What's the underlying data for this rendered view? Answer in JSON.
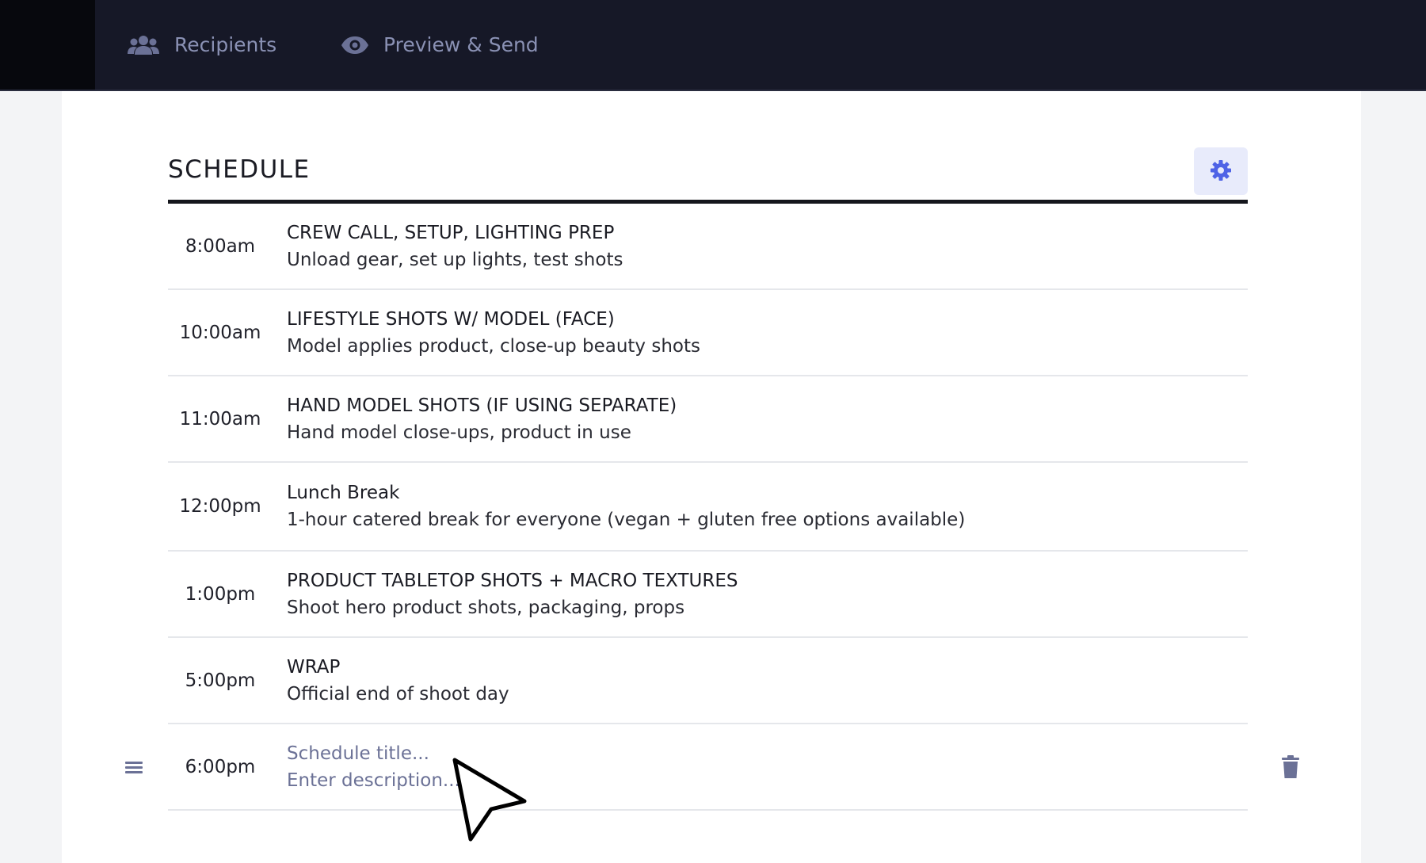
{
  "nav": {
    "items": [
      {
        "label": "Recipients",
        "icon": "users-icon"
      },
      {
        "label": "Preview & Send",
        "icon": "eye-icon"
      }
    ]
  },
  "schedule": {
    "heading": "SCHEDULE",
    "settings_icon": "gear-icon",
    "rows": [
      {
        "time": "8:00am",
        "title": "CREW CALL, SETUP, LIGHTING PREP",
        "description": "Unload gear, set up lights, test shots"
      },
      {
        "time": "10:00am",
        "title": "LIFESTYLE SHOTS W/ MODEL (FACE)",
        "description": "Model applies product, close-up beauty shots"
      },
      {
        "time": "11:00am",
        "title": "HAND MODEL SHOTS (IF USING SEPARATE)",
        "description": "Hand model close-ups, product in use"
      },
      {
        "time": "12:00pm",
        "title": "Lunch Break",
        "description": "1-hour catered break for everyone (vegan + gluten free options available)"
      },
      {
        "time": "1:00pm",
        "title": "PRODUCT TABLETOP SHOTS + MACRO TEXTURES",
        "description": "Shoot hero product shots, packaging, props"
      },
      {
        "time": "5:00pm",
        "title": "WRAP",
        "description": "Official end of shoot day"
      }
    ],
    "new_row": {
      "time": "6:00pm",
      "title_placeholder": "Schedule title...",
      "description_placeholder": "Enter description..."
    }
  },
  "colors": {
    "topbar": "#161827",
    "nav_text": "#8a91b4",
    "accent": "#4f63e6",
    "settings_bg": "#e8ebfb",
    "placeholder": "#6b7196"
  }
}
